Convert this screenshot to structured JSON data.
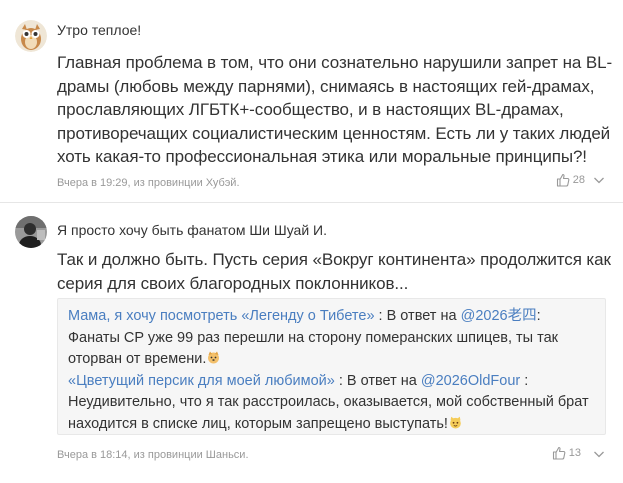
{
  "comments": [
    {
      "username": "Утро теплое!",
      "text": "Главная проблема в том, что они сознательно нарушили запрет на BL-драмы (любовь между парнями), снимаясь в настоящих гей-драмах, прославляющих ЛГБТК+-сообщество, и в настоящих BL-драмах, противоречащих социалистическим ценностям. Есть ли у таких людей хоть какая-то профессиональная этика или моральные принципы?!",
      "meta": "Вчера в 19:29, из провинции Хубэй.",
      "likes": "28",
      "avatar_icon": "owl-avatar-icon"
    },
    {
      "username": "Я просто хочу быть фанатом Ши Шуай И.",
      "text": "Так и должно быть. Пусть серия «Вокруг континента» продолжится как серия для своих благородных поклонников...",
      "meta": "Вчера в 18:14, из провинции Шаньси.",
      "likes": "13",
      "avatar_icon": "person-avatar-icon",
      "quotes": [
        {
          "title": "Мама, я хочу посмотреть «Легенду о Тибете»",
          "sep": " : В ответ на ",
          "mention": "@2026老四",
          "body": ": Фанаты CP уже 99 раз перешли на сторону померанских шпицев, ты так оторван от времени.",
          "emoji": "dog-emoji-icon"
        },
        {
          "title": "«Цветущий персик для моей любимой»",
          "sep": " : В ответ на ",
          "mention": "@2026OldFour",
          "body": " : Неудивительно, что я так расстроилась, оказывается, мой собственный брат находится в списке лиц, которым запрещено выступать!",
          "emoji": "cat-emoji-icon"
        }
      ]
    }
  ],
  "colors": {
    "link": "#4a7ec0",
    "meta": "#999999",
    "text": "#333333",
    "quote_bg": "#f6f6f6"
  }
}
